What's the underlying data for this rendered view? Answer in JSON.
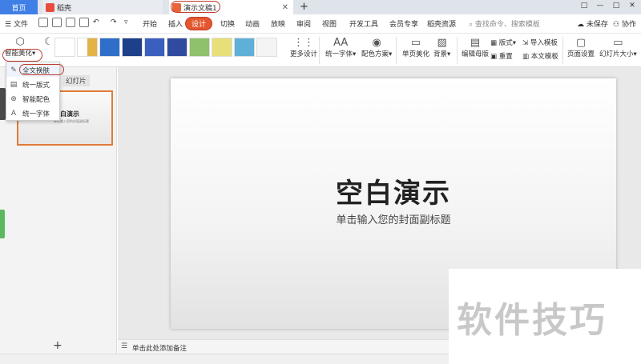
{
  "tabs": {
    "home": "首页",
    "daoke": "稻壳",
    "document": "演示文稿1",
    "add": "+"
  },
  "window_controls": [
    "□",
    "—",
    "□",
    "✕"
  ],
  "menu": {
    "file": "文件",
    "items": [
      "开始",
      "插入",
      "设计",
      "切换",
      "动画",
      "放映",
      "审阅",
      "视图",
      "开发工具",
      "会员专享",
      "稻壳资源"
    ],
    "search_placeholder": "查找命令、搜索模板",
    "unsaved": "未保存",
    "collab": "协作"
  },
  "ribbon": {
    "smart_beautify": "智能美化",
    "more_design": "更多设计",
    "unify_font": "统一字体",
    "color_scheme": "配色方案",
    "single_page_beautify": "单页美化",
    "background": "背景",
    "edit_master": "编辑母版",
    "layout": "版式",
    "reset": "重置",
    "import_template": "导入模板",
    "this_template": "本文模板",
    "page_setup": "页面设置",
    "slide_size": "幻灯片大小"
  },
  "dropdown": {
    "items": [
      "全文换肤",
      "统一版式",
      "智能配色",
      "统一字体"
    ]
  },
  "left_panel": {
    "tab_label": "幻灯片",
    "slide_number": "1",
    "thumb_title": "空白演示",
    "thumb_subtitle": "单击输入您的封面副标题",
    "add": "+"
  },
  "slide": {
    "title": "空白演示",
    "subtitle": "单击输入您的封面副标题"
  },
  "notes": {
    "placeholder": "单击此处添加备注"
  },
  "watermark": "软件技巧",
  "colors": {
    "accent_blue": "#3f7fe6",
    "highlight_red": "#c0392b",
    "design_tab": "#e4572e"
  }
}
